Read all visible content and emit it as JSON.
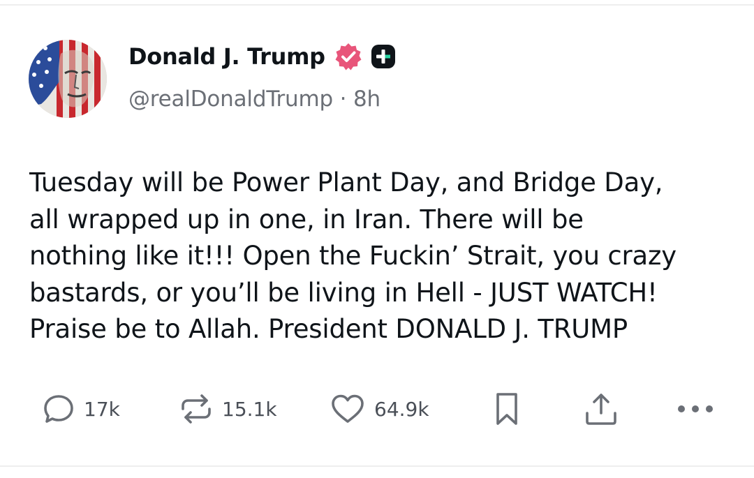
{
  "post": {
    "author": {
      "name": "Donald J. Trump",
      "handle": "@realDonaldTrump",
      "separator": "·",
      "time": "8h",
      "verified_color": "#e8557a",
      "plus_badge_color": "#0f1419",
      "plus_badge_accent": "#2bd4a4"
    },
    "lines": [
      "Tuesday will be Power Plant Day, and Bridge Day,",
      "all wrapped up in one, in Iran. There will be",
      "nothing like it!!! Open the Fuckin’ Strait, you crazy",
      "bastards, or you’ll be living in Hell - JUST WATCH!",
      "Praise be to Allah. President DONALD J. TRUMP"
    ],
    "actions": {
      "replies": "17k",
      "reposts": "15.1k",
      "likes": "64.9k"
    }
  },
  "icons": {
    "reply": "speech-bubble-icon",
    "repost": "repost-arrows-icon",
    "like": "heart-icon",
    "bookmark": "bookmark-icon",
    "share": "share-upload-icon",
    "more": "more-dots-icon"
  }
}
